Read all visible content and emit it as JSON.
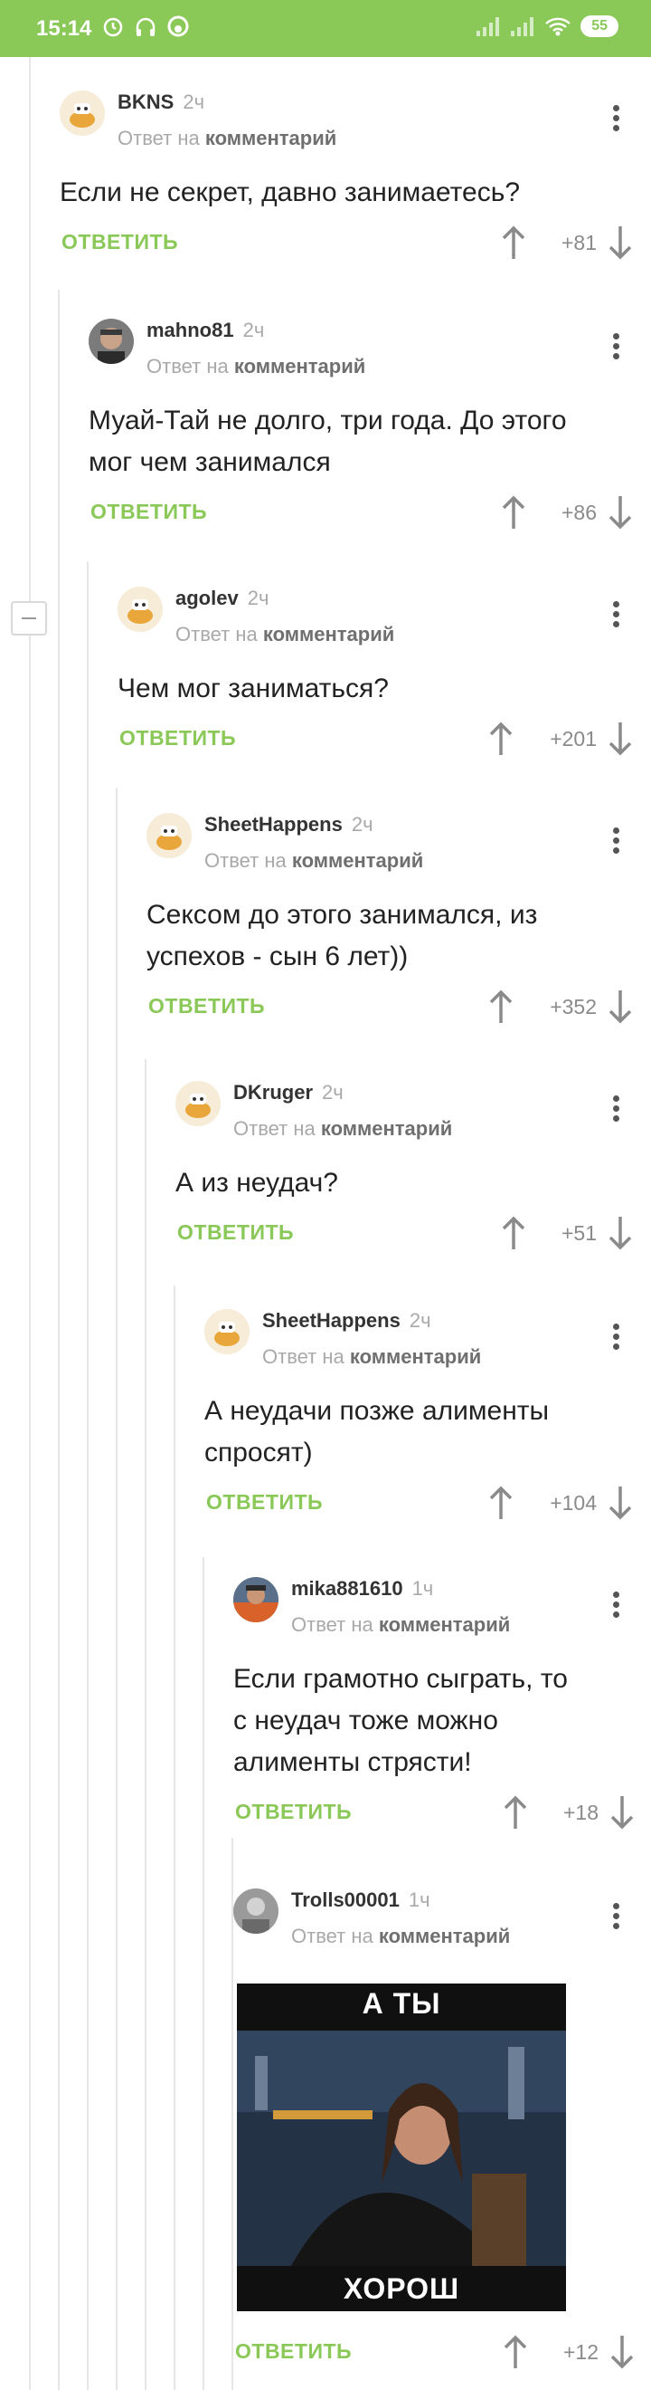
{
  "status_bar": {
    "time": "15:14",
    "battery": "55",
    "icons": [
      "alarm-icon",
      "headphones-icon",
      "app-icon",
      "signal-icon",
      "signal-icon",
      "wifi-icon",
      "battery-icon"
    ]
  },
  "colors": {
    "accent": "#8ac858",
    "muted": "#a9a9a9",
    "text": "#222222"
  },
  "ui": {
    "reply_prefix": "Ответ на",
    "reply_target": "комментарий",
    "reply_button": "ОТВЕТИТЬ"
  },
  "comments": [
    {
      "user": "BKNS",
      "time": "2ч",
      "text": "Если не секрет, давно занимаетесь?",
      "score": "+81"
    },
    {
      "user": "mahno81",
      "time": "2ч",
      "text": "Муай-Тай не долго, три года. До этого мог чем занимался",
      "score": "+86"
    },
    {
      "user": "agolev",
      "time": "2ч",
      "text": "Чем мог заниматься?",
      "score": "+201"
    },
    {
      "user": "SheetHappens",
      "time": "2ч",
      "text": "Сексом до этого занимался, из успехов - сын 6 лет))",
      "score": "+352"
    },
    {
      "user": "DKruger",
      "time": "2ч",
      "text": "А из неудач?",
      "score": "+51"
    },
    {
      "user": "SheetHappens",
      "time": "2ч",
      "text": "А неудачи позже алименты спросят)",
      "score": "+104"
    },
    {
      "user": "mika881610",
      "time": "1ч",
      "text": "Если грамотно сыграть, то с неудач тоже можно алименты стрясти!",
      "score": "+18"
    },
    {
      "user": "Trolls00001",
      "time": "1ч",
      "text": "",
      "score": "+12",
      "image": {
        "top_caption": "А ТЫ",
        "bottom_caption": "ХОРОШ"
      }
    }
  ]
}
